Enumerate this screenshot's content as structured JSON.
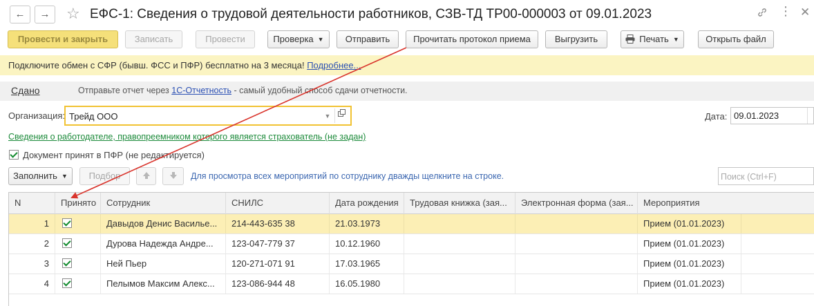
{
  "window": {
    "back_icon": "arrow-left-icon",
    "forward_icon": "arrow-right-icon",
    "favorite_icon": "star-icon",
    "title": "ЕФС-1: Сведения о трудовой деятельности работников, СЗВ-ТД ТР00-000003 от 09.01.2023",
    "link_icon": "link-icon",
    "more_icon": "more-icon",
    "close_icon": "close-icon"
  },
  "toolbar": {
    "post_close": "Провести и закрыть",
    "save": "Записать",
    "post": "Провести",
    "check": "Проверка",
    "send": "Отправить",
    "read_protocol": "Прочитать протокол приема",
    "export": "Выгрузить",
    "print": "Печать",
    "open_file": "Открыть файл"
  },
  "banner": {
    "text": "Подключите обмен с СФР (бывш. ФСС и ПФР) бесплатно на 3 месяца!",
    "link": "Подробнее..."
  },
  "status": {
    "state": "Сдано",
    "text_before": "Отправьте отчет через",
    "link": "1С-Отчетность",
    "text_after": "- самый удобный способ сдачи отчетности."
  },
  "organization": {
    "label": "Организация:",
    "value": "Трейд ООО"
  },
  "date": {
    "label": "Дата:",
    "value": "09.01.2023"
  },
  "employer_link": "Сведения о работодателе, правопреемником которого является страхователь (не задан)",
  "accepted_checkbox": {
    "label": "Документ принят в ПФР (не редактируется)",
    "checked": true
  },
  "table_toolbar": {
    "fill": "Заполнить",
    "select": "Подбор",
    "hint": "Для просмотра всех мероприятий по сотруднику дважды щелкните на строке.",
    "search_placeholder": "Поиск (Ctrl+F)"
  },
  "table": {
    "columns": [
      "N",
      "Принято",
      "Сотрудник",
      "СНИЛС",
      "Дата рождения",
      "Трудовая книжка (зая...",
      "Электронная форма (зая...",
      "Мероприятия"
    ],
    "rows": [
      {
        "n": "1",
        "accepted": true,
        "employee": "Давыдов Денис Василье...",
        "snils": "214-443-635 38",
        "birth": "21.03.1973",
        "book": "",
        "eform": "",
        "events": "Прием (01.01.2023)",
        "selected": true
      },
      {
        "n": "2",
        "accepted": true,
        "employee": "Дурова Надежда Андре...",
        "snils": "123-047-779 37",
        "birth": "10.12.1960",
        "book": "",
        "eform": "",
        "events": "Прием (01.01.2023)",
        "selected": false
      },
      {
        "n": "3",
        "accepted": true,
        "employee": "Ней Пьер",
        "snils": "120-271-071 91",
        "birth": "17.03.1965",
        "book": "",
        "eform": "",
        "events": "Прием (01.01.2023)",
        "selected": false
      },
      {
        "n": "4",
        "accepted": true,
        "employee": "Пелымов Максим Алекс...",
        "snils": "123-086-944 48",
        "birth": "16.05.1980",
        "book": "",
        "eform": "",
        "events": "Прием (01.01.2023)",
        "selected": false
      }
    ]
  },
  "colors": {
    "primary_button": "#f5e07a",
    "banner_bg": "#fbf4c2",
    "selected_row": "#fcefb5",
    "annotation_arrow": "#d9332b",
    "link_green": "#1c8a3a",
    "link_blue": "#2a4fb3"
  }
}
